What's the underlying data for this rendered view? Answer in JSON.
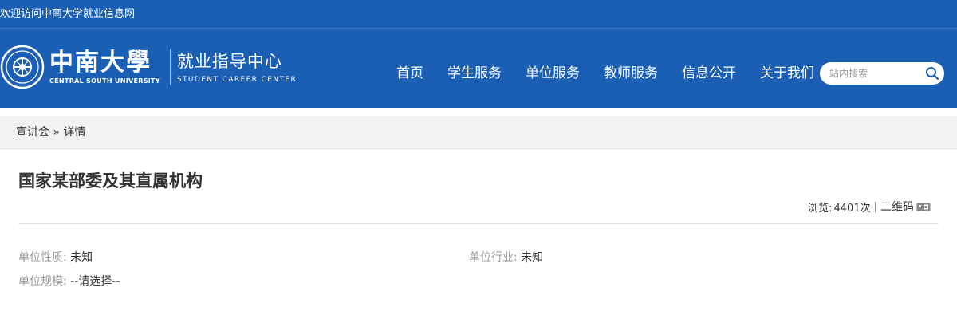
{
  "topbar": {
    "welcome": "欢迎访问中南大学就业信息网"
  },
  "logo": {
    "cn": "中南大學",
    "en": "CENTRAL SOUTH UNIVERSITY",
    "center_cn": "就业指导中心",
    "center_en": "STUDENT CAREER CENTER"
  },
  "nav": [
    {
      "label": "首页"
    },
    {
      "label": "学生服务"
    },
    {
      "label": "单位服务"
    },
    {
      "label": "教师服务"
    },
    {
      "label": "信息公开"
    },
    {
      "label": "关于我们"
    }
  ],
  "search": {
    "placeholder": "站内搜索",
    "icon": "search-icon"
  },
  "breadcrumb": {
    "parent": "宣讲会",
    "separator": "»",
    "current": "详情"
  },
  "article": {
    "title": "国家某部委及其直属机构",
    "views_label": "浏览:",
    "views": "4401次",
    "separator": "|",
    "qr_label": "二维码",
    "qr_icon": "qrcode-icon"
  },
  "info": {
    "nature_label": "单位性质:",
    "nature_value": "未知",
    "industry_label": "单位行业:",
    "industry_value": "未知",
    "scale_label": "单位规模:",
    "scale_value": "--请选择--"
  },
  "colors": {
    "brand": "#1a5fb4",
    "bar": "#f2f2f2"
  }
}
